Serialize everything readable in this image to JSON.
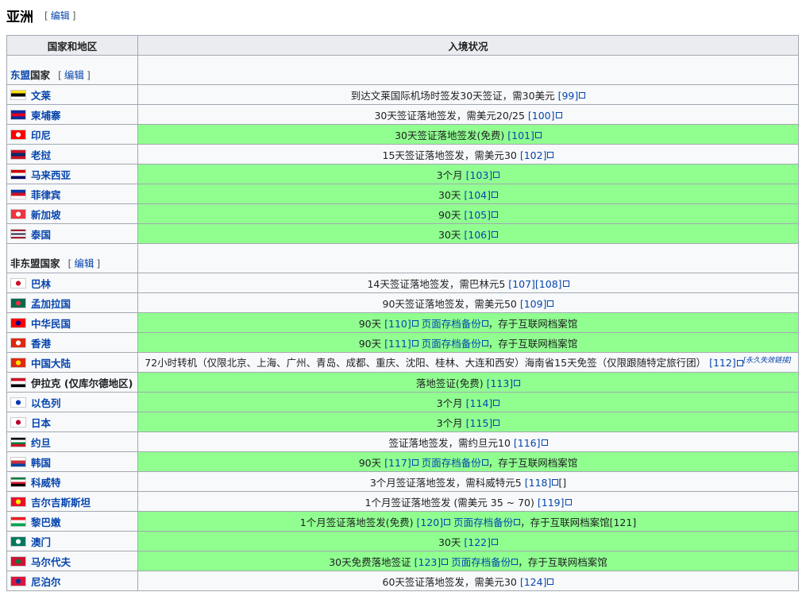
{
  "section": {
    "title": "亚洲",
    "edit_label": "编辑"
  },
  "table": {
    "headers": {
      "country": "国家和地区",
      "status": "入境状况"
    },
    "groups": [
      {
        "label_blue": "东盟",
        "label_rest": "国家",
        "edit_label": "编辑",
        "rows": [
          {
            "name": "文莱",
            "status": "到达文莱国际机场时签发30天签证，需30美元",
            "refs": "[99]",
            "green": false,
            "flag": "bn"
          },
          {
            "name": "柬埔寨",
            "status": "30天签证落地签发，需美元20/25",
            "refs": "[100]",
            "green": false,
            "flag": "kh"
          },
          {
            "name": "印尼",
            "status": "30天签证落地签发(免费)",
            "refs": "[101]",
            "green": true,
            "flag": "id"
          },
          {
            "name": "老挝",
            "status": "15天签证落地签发，需美元30",
            "refs": "[102]",
            "green": false,
            "flag": "la"
          },
          {
            "name": "马来西亚",
            "status": "3个月",
            "refs": "[103]",
            "green": true,
            "flag": "my"
          },
          {
            "name": "菲律宾",
            "status": "30天",
            "refs": "[104]",
            "green": true,
            "flag": "ph"
          },
          {
            "name": "新加坡",
            "status": "90天",
            "refs": "[105]",
            "green": true,
            "flag": "sg"
          },
          {
            "name": "泰国",
            "status": "30天",
            "refs": "[106]",
            "green": true,
            "flag": "th"
          }
        ]
      },
      {
        "label_blue": "",
        "label_rest": "非东盟国家",
        "edit_label": "编辑",
        "rows": [
          {
            "name": "巴林",
            "status": "14天签证落地签发，需巴林元5",
            "refs": "[107][108]",
            "green": false,
            "flag": "bh"
          },
          {
            "name": "孟加拉国",
            "status": "90天签证落地签发，需美元50",
            "refs": "[109]",
            "green": false,
            "flag": "bd"
          },
          {
            "name": "中华民国",
            "status": "90天",
            "refs": "[110]",
            "archive": "页面存档备份",
            "archive_tail": "，存于互联网档案馆",
            "green": true,
            "flag": "tw"
          },
          {
            "name": "香港",
            "status": "90天",
            "refs": "[111]",
            "archive": "页面存档备份",
            "archive_tail": "，存于互联网档案馆",
            "green": true,
            "flag": "hk"
          },
          {
            "name": "中国大陆",
            "status": "72小时转机（仅限北京、上海、广州、青岛、成都、重庆、沈阳、桂林、大连和西安）海南省15天免签（仅限跟随特定旅行团）",
            "refs": "[112]",
            "sup": "[永久失效链接]",
            "green": false,
            "flag": "cn",
            "small": true
          },
          {
            "name": "伊拉克 (仅库尔德地区)",
            "status": "落地签证(免费)",
            "refs": "[113]",
            "green": true,
            "flag": "iq",
            "plain": true
          },
          {
            "name": "以色列",
            "status": "3个月",
            "refs": "[114]",
            "green": true,
            "flag": "il"
          },
          {
            "name": "日本",
            "status": "3个月",
            "refs": "[115]",
            "green": true,
            "flag": "jp"
          },
          {
            "name": "约旦",
            "status": "签证落地签发，需约旦元10",
            "refs": "[116]",
            "green": false,
            "flag": "jo"
          },
          {
            "name": "韩国",
            "status": "90天",
            "refs": "[117]",
            "archive": "页面存档备份",
            "archive_tail": "，存于互联网档案馆",
            "green": true,
            "flag": "kr"
          },
          {
            "name": "科威特",
            "status": "3个月签证落地签发，需科威特元5",
            "refs": "[118]",
            "tail": "[]",
            "green": false,
            "flag": "kw"
          },
          {
            "name": "吉尔吉斯斯坦",
            "status": "1个月签证落地签发 (需美元 35 ~ 70)",
            "refs": "[119]",
            "green": false,
            "flag": "kg"
          },
          {
            "name": "黎巴嫩",
            "status": "1个月签证落地签发(免费)",
            "refs": "[120]",
            "archive": "页面存档备份",
            "archive_tail": "，存于互联网档案馆[121]",
            "green": true,
            "flag": "lb"
          },
          {
            "name": "澳门",
            "status": "30天",
            "refs": "[122]",
            "green": true,
            "flag": "mo"
          },
          {
            "name": "马尔代夫",
            "status": "30天免费落地签证",
            "refs": "[123]",
            "archive": "页面存档备份",
            "archive_tail": "，存于互联网档案馆",
            "green": true,
            "flag": "mv"
          },
          {
            "name": "尼泊尔",
            "status": "60天签证落地签发，需美元30",
            "refs": "[124]",
            "green": false,
            "flag": "np"
          }
        ]
      }
    ]
  },
  "flag_colors": {
    "bn": [
      "#f7e017",
      "#000000",
      "#ffffff"
    ],
    "kh": [
      "#032ea1",
      "#e00025",
      "#032ea1"
    ],
    "id": [
      "#ff0000",
      "#ffffff"
    ],
    "la": [
      "#ce1126",
      "#002868",
      "#ce1126"
    ],
    "my": [
      "#cc0001",
      "#ffffff",
      "#010066"
    ],
    "ph": [
      "#0038a8",
      "#ce1126",
      "#ffffff"
    ],
    "sg": [
      "#ef3340",
      "#ffffff"
    ],
    "th": [
      "#a51931",
      "#f4f5f8",
      "#2d2a4a",
      "#f4f5f8",
      "#a51931"
    ],
    "bh": [
      "#ffffff",
      "#ce1126"
    ],
    "bd": [
      "#006a4e",
      "#f42a41"
    ],
    "tw": [
      "#fe0000",
      "#000095"
    ],
    "hk": [
      "#de2910",
      "#ffffff"
    ],
    "cn": [
      "#de2910",
      "#ffde00"
    ],
    "iq": [
      "#ce1126",
      "#ffffff",
      "#000000"
    ],
    "il": [
      "#ffffff",
      "#0038b8"
    ],
    "jp": [
      "#ffffff",
      "#bc002d"
    ],
    "jo": [
      "#000000",
      "#ffffff",
      "#007a3d",
      "#ce1126"
    ],
    "kr": [
      "#ffffff",
      "#cd2e3a",
      "#0047a0"
    ],
    "kw": [
      "#007a3d",
      "#ffffff",
      "#ce1126",
      "#000000"
    ],
    "kg": [
      "#e8112d",
      "#ffef00"
    ],
    "lb": [
      "#ed1c24",
      "#ffffff",
      "#00a651"
    ],
    "mo": [
      "#00785e",
      "#ffffff"
    ],
    "mv": [
      "#d21034",
      "#007e3a"
    ],
    "np": [
      "#dc143c",
      "#003893"
    ]
  }
}
